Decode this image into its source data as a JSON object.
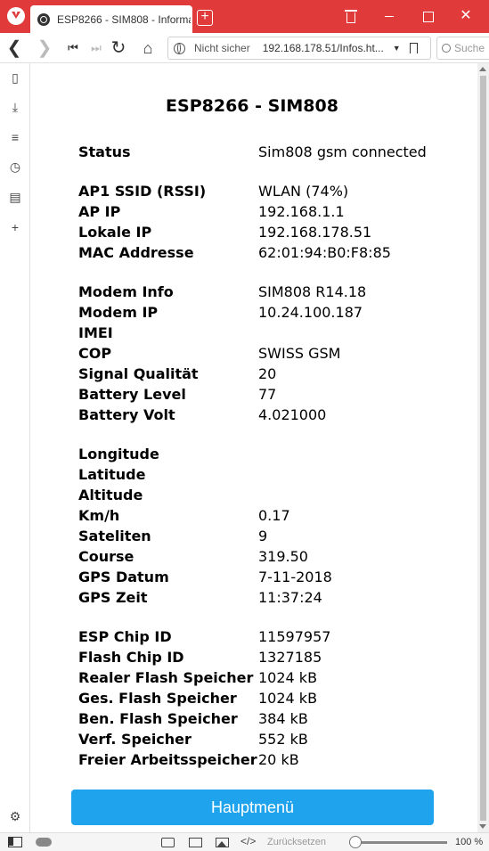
{
  "browser": {
    "tab_title": "ESP8266 - SIM808 - Informat",
    "new_tab": "+",
    "close_symbol": "✕",
    "security_label": "Nicht sicher",
    "url": "192.168.178.51/Infos.ht...",
    "search_placeholder": "Suche",
    "accent_color": "#e03a3a"
  },
  "page": {
    "title": "ESP8266 - SIM808",
    "groups": [
      [
        {
          "label": "Status",
          "value": "Sim808 gsm connected"
        }
      ],
      [
        {
          "label": "AP1 SSID (RSSI)",
          "value": "WLAN (74%)"
        },
        {
          "label": "AP IP",
          "value": "192.168.1.1"
        },
        {
          "label": "Lokale IP",
          "value": "192.168.178.51"
        },
        {
          "label": "MAC Addresse",
          "value": "62:01:94:B0:F8:85"
        }
      ],
      [
        {
          "label": "Modem Info",
          "value": "SIM808 R14.18"
        },
        {
          "label": "Modem IP",
          "value": "10.24.100.187"
        },
        {
          "label": "IMEI",
          "value": ""
        },
        {
          "label": "COP",
          "value": "SWISS GSM"
        },
        {
          "label": "Signal Qualität",
          "value": "20"
        },
        {
          "label": "Battery Level",
          "value": "77"
        },
        {
          "label": "Battery Volt",
          "value": "4.021000"
        }
      ],
      [
        {
          "label": "Longitude",
          "value": ""
        },
        {
          "label": "Latitude",
          "value": ""
        },
        {
          "label": "Altitude",
          "value": ""
        },
        {
          "label": "Km/h",
          "value": "0.17"
        },
        {
          "label": "Sateliten",
          "value": "9"
        },
        {
          "label": "Course",
          "value": "319.50"
        },
        {
          "label": "GPS Datum",
          "value": "7-11-2018"
        },
        {
          "label": "GPS Zeit",
          "value": "11:37:24"
        }
      ],
      [
        {
          "label": "ESP Chip ID",
          "value": "11597957"
        },
        {
          "label": "Flash Chip ID",
          "value": "1327185"
        },
        {
          "label": "Realer Flash Speicher",
          "value": "1024 kB"
        },
        {
          "label": "Ges. Flash Speicher",
          "value": "1024 kB"
        },
        {
          "label": "Ben. Flash Speicher",
          "value": "384 kB"
        },
        {
          "label": "Verf. Speicher",
          "value": "552 kB"
        },
        {
          "label": "Freier Arbeitsspeicher",
          "value": "20 kB"
        }
      ]
    ],
    "main_button": "Hauptmenü",
    "button_color": "#1fa3ec"
  },
  "statusbar": {
    "reset_label": "Zurücksetzen",
    "zoom": "100 %",
    "zoom_level": 0.0
  }
}
